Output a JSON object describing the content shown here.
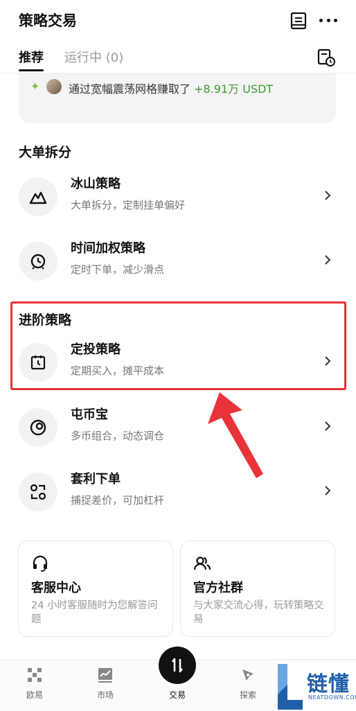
{
  "header": {
    "title": "策略交易"
  },
  "tabs": [
    {
      "label": "推荐",
      "active": true
    },
    {
      "label": "运行中 (0)",
      "active": false
    }
  ],
  "banner": {
    "text_prefix": "通过宽幅震荡网格赚取了",
    "amount": "+8.91万 USDT"
  },
  "sections": [
    {
      "title": "大单拆分",
      "items": [
        {
          "name": "冰山策略",
          "desc": "大单拆分，定制挂单偏好",
          "icon": "mountain-icon"
        },
        {
          "name": "时间加权策略",
          "desc": "定时下单，减少滑点",
          "icon": "alarm-clock-icon"
        }
      ]
    },
    {
      "title": "进阶策略",
      "items": [
        {
          "name": "定投策略",
          "desc": "定期买入，摊平成本",
          "icon": "calendar-icon"
        },
        {
          "name": "屯币宝",
          "desc": "多币组合，动态调仓",
          "icon": "coin-stack-icon"
        },
        {
          "name": "套利下单",
          "desc": "捕捉差价，可加杠杆",
          "icon": "arbitrage-icon"
        }
      ]
    }
  ],
  "cards": [
    {
      "title": "客服中心",
      "desc": "24 小时客服随时为您解答问题",
      "icon": "headset-icon"
    },
    {
      "title": "官方社群",
      "desc": "与大家交流心得，玩转策略交易",
      "icon": "community-icon"
    }
  ],
  "bottom_nav": [
    {
      "label": "欧易",
      "icon": "okx-logo-icon"
    },
    {
      "label": "市场",
      "icon": "market-chart-icon"
    },
    {
      "label": "交易",
      "icon": "trade-swap-icon",
      "active": true
    },
    {
      "label": "探索",
      "icon": "compass-icon"
    }
  ],
  "watermark": {
    "text": "链懂",
    "sub": "NEATDOWN.COM"
  },
  "colors": {
    "highlight_border": "#e8333a",
    "profit_green": "#3a9a2f",
    "watermark_blue": "#1f5fa8"
  }
}
